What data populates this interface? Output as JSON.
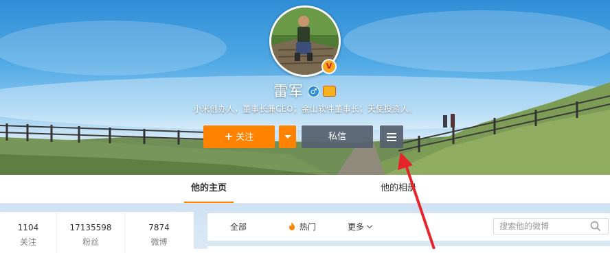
{
  "profile": {
    "name": "雷军",
    "vip_badge": "V",
    "gender_icon": "male-icon",
    "gender_symbol": "♂",
    "level_icon": "level-badge-icon",
    "bio": "小米创办人，董事长兼CEO；金山软件董事长；天使投资人。"
  },
  "actions": {
    "follow_plus": "+",
    "follow_label": "关注",
    "message_label": "私信",
    "follow_more_icon": "caret-down-icon",
    "menu_icon": "menu-icon"
  },
  "tabs": [
    {
      "label": "他的主页",
      "active": true
    },
    {
      "label": "他的相册",
      "active": false
    }
  ],
  "stats": [
    {
      "value": "1104",
      "label": "关注"
    },
    {
      "value": "17135598",
      "label": "粉丝"
    },
    {
      "value": "7874",
      "label": "微博"
    }
  ],
  "feed_filter": {
    "all_label": "全部",
    "hot_label": "热门",
    "hot_icon": "flame-icon",
    "more_label": "更多",
    "more_icon": "chevron-down-icon",
    "search_placeholder": "搜索他的微博",
    "search_icon": "search-icon"
  },
  "colors": {
    "accent": "#ff8200",
    "button_dark": "#555e6e",
    "annotation_arrow": "#e8242b"
  }
}
